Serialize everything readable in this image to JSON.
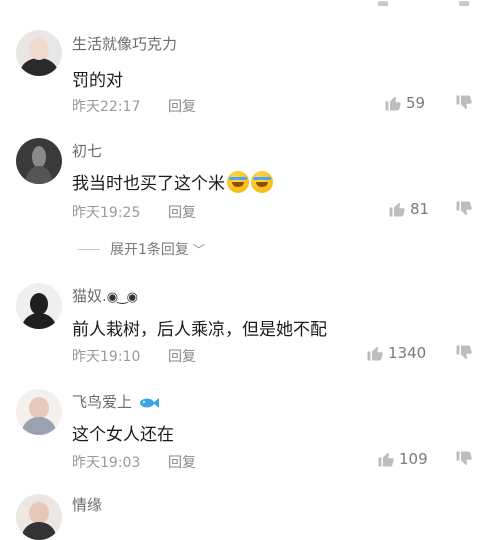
{
  "comments": [
    {
      "username": "生活就像巧克力",
      "text": "罚的对",
      "time": "昨天22:17",
      "reply": "回复",
      "likes": "59"
    },
    {
      "username": "初七",
      "text": "我当时也买了这个米",
      "time": "昨天19:25",
      "reply": "回复",
      "likes": "81",
      "emoji": [
        "laugh-cry-emoji",
        "laugh-cry-emoji"
      ]
    },
    {
      "username": "猫奴.",
      "username_suffix": "◉‿◉",
      "text": "前人栽树，后人乘凉，但是她不配",
      "time": "昨天19:10",
      "reply": "回复",
      "likes": "1340"
    },
    {
      "username": "飞鸟爱上",
      "username_icon": "fish-icon",
      "text": "这个女人还在",
      "time": "昨天19:03",
      "reply": "回复",
      "likes": "109"
    },
    {
      "username": "情缘"
    }
  ],
  "expand_replies": {
    "label": "展开1条回复"
  },
  "colors": {
    "text": "#1b1b1b",
    "meta": "#9a9a9a",
    "username": "#6c6c6c",
    "icon": "#bdbdbd"
  },
  "icons": {
    "like": "thumbs-up-icon",
    "dislike": "thumbs-down-icon",
    "expand": "chevron-down-icon"
  }
}
